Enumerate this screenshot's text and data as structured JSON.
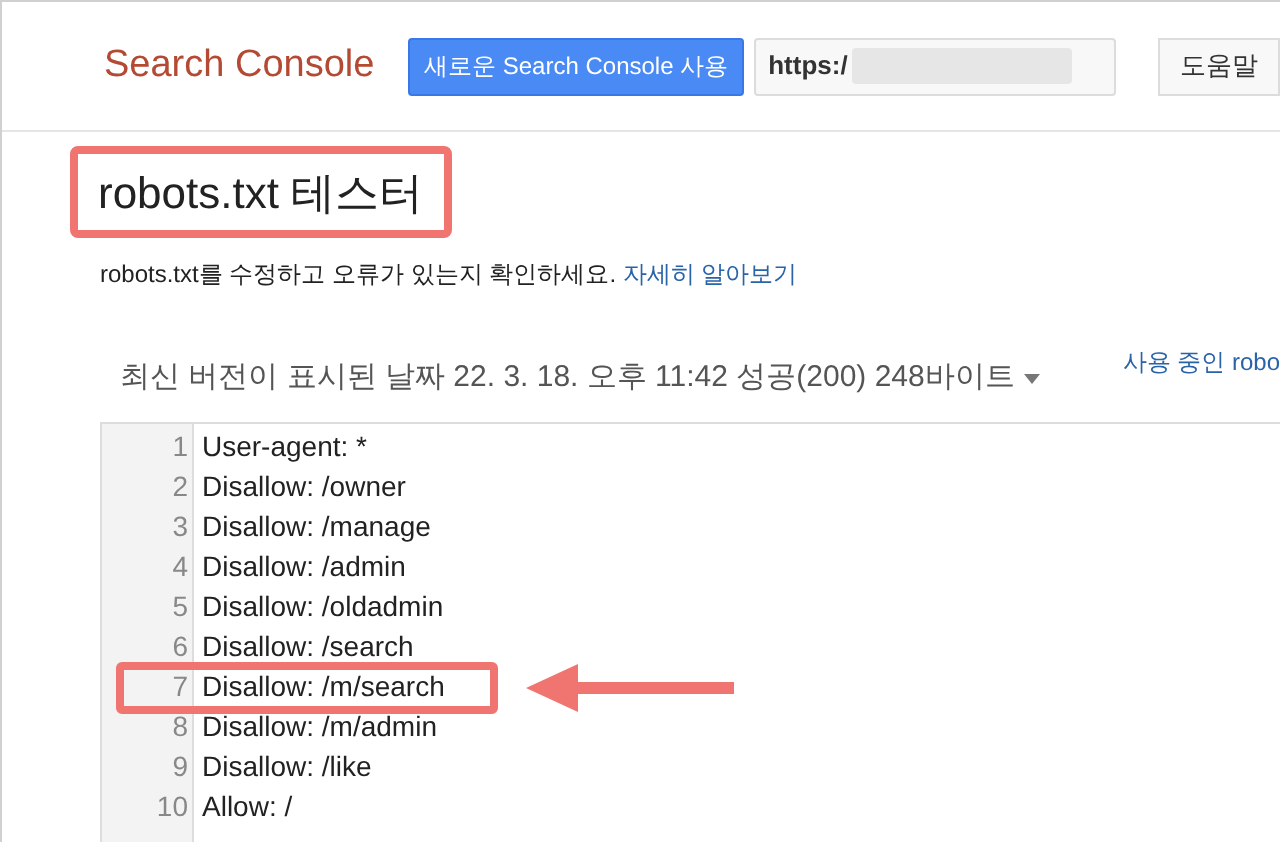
{
  "header": {
    "logo": "Search Console",
    "new_button": "새로운 Search Console 사용",
    "url": {
      "value": "https:/"
    },
    "help_button": "도움말"
  },
  "title": {
    "text": "robots.txt 테스터",
    "highlighted": true
  },
  "description": {
    "text": "robots.txt를 수정하고 오류가 있는지 확인하세요.",
    "link": "자세히 알아보기"
  },
  "version": {
    "text": "최신 버전이 표시된 날짜 22. 3. 18. 오후 11:42 성공(200) 248바이트",
    "link": "사용 중인 robo"
  },
  "editor": {
    "lines": [
      {
        "number": "1",
        "text": "User-agent: *",
        "highlighted": false
      },
      {
        "number": "2",
        "text": "Disallow: /owner",
        "highlighted": false
      },
      {
        "number": "3",
        "text": "Disallow: /manage",
        "highlighted": false
      },
      {
        "number": "4",
        "text": "Disallow: /admin",
        "highlighted": false
      },
      {
        "number": "5",
        "text": "Disallow: /oldadmin",
        "highlighted": false
      },
      {
        "number": "6",
        "text": "Disallow: /search",
        "highlighted": false
      },
      {
        "number": "7",
        "text": "Disallow: /m/search",
        "highlighted": true
      },
      {
        "number": "8",
        "text": "Disallow: /m/admin",
        "highlighted": false
      },
      {
        "number": "9",
        "text": "Disallow: /like",
        "highlighted": false
      },
      {
        "number": "10",
        "text": "Allow: /",
        "highlighted": false
      }
    ]
  }
}
